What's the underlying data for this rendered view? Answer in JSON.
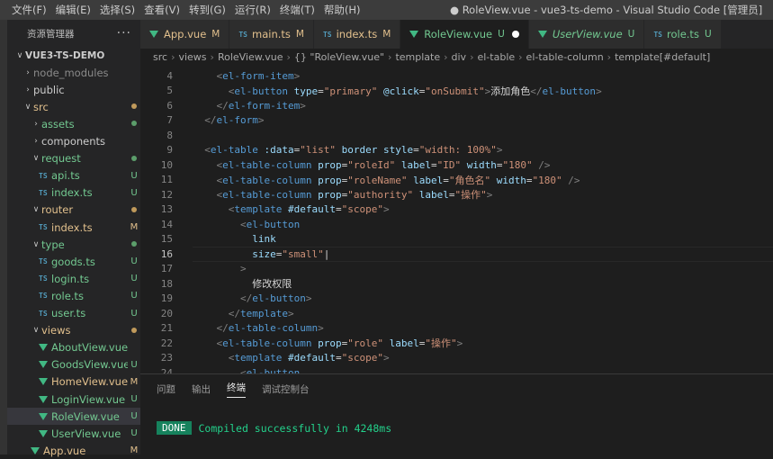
{
  "titlebar": {
    "menu": [
      "文件(F)",
      "编辑(E)",
      "选择(S)",
      "查看(V)",
      "转到(G)",
      "运行(R)",
      "终端(T)",
      "帮助(H)"
    ],
    "window_title": "● RoleView.vue - vue3-ts-demo - Visual Studio Code [管理员]"
  },
  "sidebar": {
    "header": "资源管理器",
    "more": "···",
    "tree": [
      {
        "label": "VUE3-TS-DEMO",
        "kind": "root",
        "depth": 0,
        "chev": "∨",
        "badge": ""
      },
      {
        "label": "node_modules",
        "kind": "folder",
        "depth": 1,
        "chev": "›",
        "badge": "",
        "dim": true
      },
      {
        "label": "public",
        "kind": "folder",
        "depth": 1,
        "chev": "›",
        "badge": ""
      },
      {
        "label": "src",
        "kind": "folder",
        "depth": 1,
        "chev": "∨",
        "badge": "dot-orange"
      },
      {
        "label": "assets",
        "kind": "folder",
        "depth": 2,
        "chev": "›",
        "badge": "dot-green"
      },
      {
        "label": "components",
        "kind": "folder",
        "depth": 2,
        "chev": "›",
        "badge": ""
      },
      {
        "label": "request",
        "kind": "folder",
        "depth": 2,
        "chev": "∨",
        "badge": "dot-green"
      },
      {
        "label": "api.ts",
        "kind": "ts",
        "depth": 3,
        "badge": "U"
      },
      {
        "label": "index.ts",
        "kind": "ts",
        "depth": 3,
        "badge": "U"
      },
      {
        "label": "router",
        "kind": "folder",
        "depth": 2,
        "chev": "∨",
        "badge": "dot-orange"
      },
      {
        "label": "index.ts",
        "kind": "ts",
        "depth": 3,
        "badge": "M"
      },
      {
        "label": "type",
        "kind": "folder",
        "depth": 2,
        "chev": "∨",
        "badge": "dot-green"
      },
      {
        "label": "goods.ts",
        "kind": "ts",
        "depth": 3,
        "badge": "U"
      },
      {
        "label": "login.ts",
        "kind": "ts",
        "depth": 3,
        "badge": "U"
      },
      {
        "label": "role.ts",
        "kind": "ts",
        "depth": 3,
        "badge": "U"
      },
      {
        "label": "user.ts",
        "kind": "ts",
        "depth": 3,
        "badge": "U"
      },
      {
        "label": "views",
        "kind": "folder",
        "depth": 2,
        "chev": "∨",
        "badge": "dot-orange"
      },
      {
        "label": "AboutView.vue",
        "kind": "vue",
        "depth": 3,
        "badge": ""
      },
      {
        "label": "GoodsView.vue",
        "kind": "vue",
        "depth": 3,
        "badge": "U"
      },
      {
        "label": "HomeView.vue",
        "kind": "vue",
        "depth": 3,
        "badge": "M"
      },
      {
        "label": "LoginView.vue",
        "kind": "vue",
        "depth": 3,
        "badge": "U"
      },
      {
        "label": "RoleView.vue",
        "kind": "vue",
        "depth": 3,
        "badge": "U",
        "selected": true
      },
      {
        "label": "UserView.vue",
        "kind": "vue",
        "depth": 3,
        "badge": "U"
      },
      {
        "label": "App.vue",
        "kind": "vue",
        "depth": 2,
        "badge": "M"
      }
    ]
  },
  "tabs": [
    {
      "label": "App.vue",
      "kind": "vue",
      "status": "M"
    },
    {
      "label": "main.ts",
      "kind": "ts",
      "status": "M"
    },
    {
      "label": "index.ts",
      "kind": "ts",
      "status": "M"
    },
    {
      "label": "RoleView.vue",
      "kind": "vue",
      "status": "U",
      "active": true,
      "dirty": true
    },
    {
      "label": "UserView.vue",
      "kind": "vue",
      "status": "U",
      "italic": true
    },
    {
      "label": "role.ts",
      "kind": "ts",
      "status": "U"
    }
  ],
  "breadcrumbs": [
    "src",
    "views",
    "RoleView.vue",
    "{} \"RoleView.vue\"",
    "template",
    "div",
    "el-table",
    "el-table-column",
    "template[#default]"
  ],
  "editor": {
    "current_line": 16,
    "lines": [
      {
        "n": 4,
        "html": "    <span class='p'>&lt;</span><span class='t'>el-form-item</span><span class='p'>&gt;</span>"
      },
      {
        "n": 5,
        "html": "      <span class='p'>&lt;</span><span class='t'>el-button</span> <span class='a'>type</span><span class='x'>=</span><span class='s'>\"primary\"</span> <span class='a'>@click</span><span class='x'>=</span><span class='s'>\"onSubmit\"</span><span class='p'>&gt;</span><span class='x'>添加角色</span><span class='p'>&lt;/</span><span class='t'>el-button</span><span class='p'>&gt;</span>"
      },
      {
        "n": 6,
        "html": "    <span class='p'>&lt;/</span><span class='t'>el-form-item</span><span class='p'>&gt;</span>"
      },
      {
        "n": 7,
        "html": "  <span class='p'>&lt;/</span><span class='t'>el-form</span><span class='p'>&gt;</span>"
      },
      {
        "n": 8,
        "html": ""
      },
      {
        "n": 9,
        "html": "  <span class='p'>&lt;</span><span class='t'>el-table</span> <span class='a'>:data</span><span class='x'>=</span><span class='s'>\"list\"</span> <span class='a'>border</span> <span class='a'>style</span><span class='x'>=</span><span class='s'>\"width: 100%\"</span><span class='p'>&gt;</span>"
      },
      {
        "n": 10,
        "html": "    <span class='p'>&lt;</span><span class='t'>el-table-column</span> <span class='a'>prop</span><span class='x'>=</span><span class='s'>\"roleId\"</span> <span class='a'>label</span><span class='x'>=</span><span class='s'>\"ID\"</span> <span class='a'>width</span><span class='x'>=</span><span class='s'>\"180\"</span> <span class='p'>/&gt;</span>"
      },
      {
        "n": 11,
        "html": "    <span class='p'>&lt;</span><span class='t'>el-table-column</span> <span class='a'>prop</span><span class='x'>=</span><span class='s'>\"roleName\"</span> <span class='a'>label</span><span class='x'>=</span><span class='s'>\"角色名\"</span> <span class='a'>width</span><span class='x'>=</span><span class='s'>\"180\"</span> <span class='p'>/&gt;</span>"
      },
      {
        "n": 12,
        "html": "    <span class='p'>&lt;</span><span class='t'>el-table-column</span> <span class='a'>prop</span><span class='x'>=</span><span class='s'>\"authority\"</span> <span class='a'>label</span><span class='x'>=</span><span class='s'>\"操作\"</span><span class='p'>&gt;</span>"
      },
      {
        "n": 13,
        "html": "      <span class='p'>&lt;</span><span class='t'>template</span> <span class='a'>#default</span><span class='x'>=</span><span class='s'>\"scope\"</span><span class='p'>&gt;</span>"
      },
      {
        "n": 14,
        "html": "        <span class='p'>&lt;</span><span class='t'>el-button</span>"
      },
      {
        "n": 15,
        "html": "          <span class='a'>link</span>"
      },
      {
        "n": 16,
        "html": "          <span class='a'>size</span><span class='x'>=</span><span class='s'>\"small\"</span><span class='x'>|</span>"
      },
      {
        "n": 17,
        "html": "        <span class='p'>&gt;</span>"
      },
      {
        "n": 18,
        "html": "          <span class='x'>修改权限</span>"
      },
      {
        "n": 19,
        "html": "        <span class='p'>&lt;/</span><span class='t'>el-button</span><span class='p'>&gt;</span>"
      },
      {
        "n": 20,
        "html": "      <span class='p'>&lt;/</span><span class='t'>template</span><span class='p'>&gt;</span>"
      },
      {
        "n": 21,
        "html": "    <span class='p'>&lt;/</span><span class='t'>el-table-column</span><span class='p'>&gt;</span>"
      },
      {
        "n": 22,
        "html": "    <span class='p'>&lt;</span><span class='t'>el-table-column</span> <span class='a'>prop</span><span class='x'>=</span><span class='s'>\"role\"</span> <span class='a'>label</span><span class='x'>=</span><span class='s'>\"操作\"</span><span class='p'>&gt;</span>"
      },
      {
        "n": 23,
        "html": "      <span class='p'>&lt;</span><span class='t'>template</span> <span class='a'>#default</span><span class='x'>=</span><span class='s'>\"scope\"</span><span class='p'>&gt;</span>"
      },
      {
        "n": 24,
        "html": "        <span class='p'>&lt;</span><span class='t'>el-button</span>"
      }
    ]
  },
  "panel": {
    "tabs": [
      "问题",
      "输出",
      "终端",
      "调试控制台"
    ],
    "active_tab": "终端",
    "badge": "DONE",
    "message": "Compiled successfully in 4248ms"
  },
  "colors": {
    "accent_green": "#41b883",
    "modified": "#e2c08d",
    "untracked": "#73c991",
    "done_badge": "#16825d"
  }
}
